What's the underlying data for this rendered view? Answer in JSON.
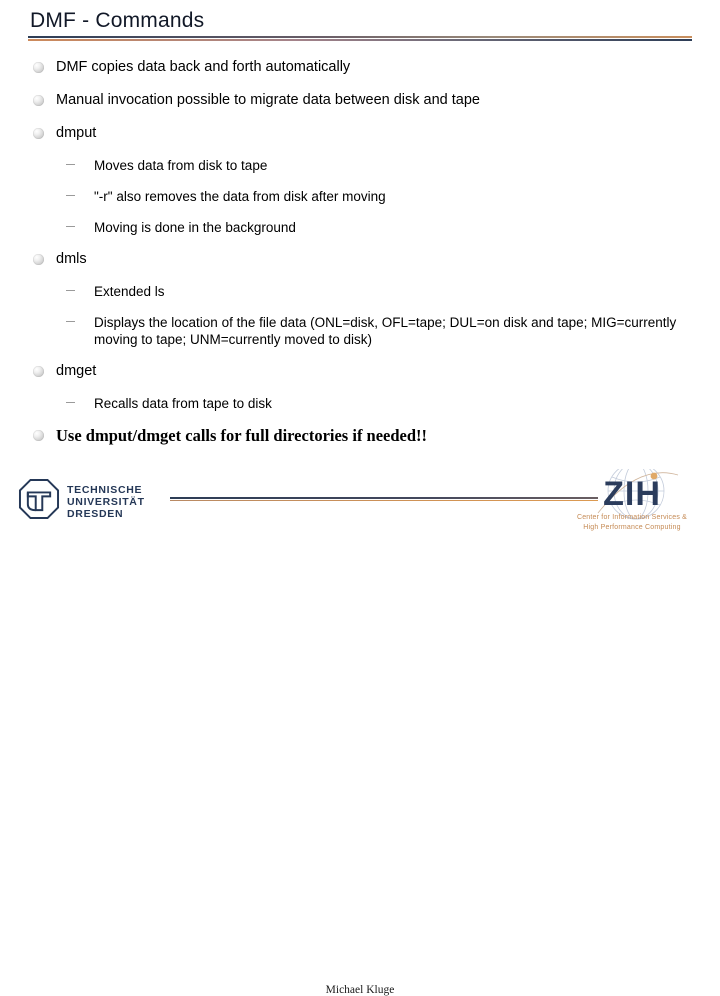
{
  "slide": {
    "title": "DMF - Commands",
    "accent_dark": "#2d3d56",
    "accent_orange": "#cd8a5b"
  },
  "content": {
    "items": [
      {
        "level": 1,
        "style": "sans",
        "text": "DMF copies data back and forth automatically",
        "bullet_icon": "sphere-bullet-icon"
      },
      {
        "level": 1,
        "style": "sans",
        "text": "Manual invocation possible to migrate data between disk and tape",
        "bullet_icon": "sphere-bullet-icon"
      },
      {
        "level": 1,
        "style": "sans",
        "text": "dmput",
        "bullet_icon": "sphere-bullet-icon"
      },
      {
        "level": 2,
        "style": "sans",
        "text": "Moves data from disk to tape",
        "bullet_icon": "dash-bullet-icon"
      },
      {
        "level": 2,
        "style": "sans",
        "text": "\"-r\" also removes the data from disk after moving",
        "bullet_icon": "dash-bullet-icon"
      },
      {
        "level": 2,
        "style": "sans",
        "text": "Moving is done in the background",
        "bullet_icon": "dash-bullet-icon"
      },
      {
        "level": 1,
        "style": "sans",
        "text": "dmls",
        "bullet_icon": "sphere-bullet-icon"
      },
      {
        "level": 2,
        "style": "sans",
        "text": "Extended ls",
        "bullet_icon": "dash-bullet-icon"
      },
      {
        "level": 2,
        "style": "sans",
        "text": "Displays the location of the file data (ONL=disk, OFL=tape; DUL=on disk and tape; MIG=currently moving to tape; UNM=currently moved to disk)",
        "bullet_icon": "dash-bullet-icon"
      },
      {
        "level": 1,
        "style": "sans",
        "text": "dmget",
        "bullet_icon": "sphere-bullet-icon"
      },
      {
        "level": 2,
        "style": "sans",
        "text": "Recalls data from tape to disk",
        "bullet_icon": "dash-bullet-icon"
      },
      {
        "level": 1,
        "style": "serif",
        "text": "Use dmput/dmget calls for full directories if needed!!",
        "bullet_icon": "sphere-bullet-icon"
      }
    ]
  },
  "footer": {
    "presenter": "Michael Kluge",
    "tud_logo": {
      "mark_icon": "tu-dresden-octagon-icon",
      "line1": "TECHNISCHE",
      "line2": "UNIVERSITÄT",
      "line3": "DRESDEN",
      "color": "#253857"
    },
    "zih_logo": {
      "mark_icon": "zih-globe-icon",
      "wordmark": "ZIH",
      "subtitle_line1": "Center for Information Services &",
      "subtitle_line2": "High Performance Computing",
      "wordmark_color": "#2b3c5c",
      "subtitle_color": "#c58a54"
    }
  }
}
